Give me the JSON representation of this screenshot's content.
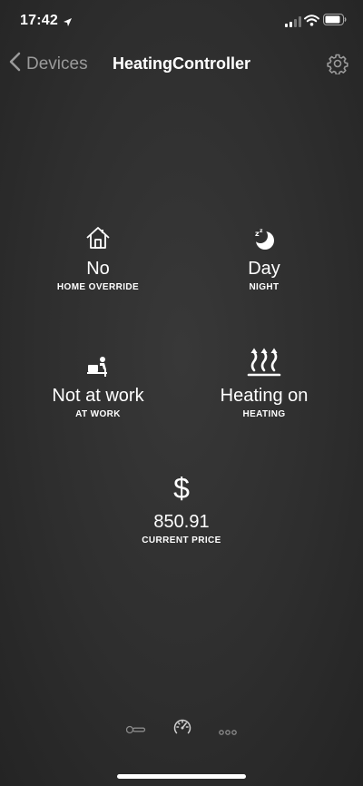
{
  "status_bar": {
    "time": "17:42",
    "icons": [
      "location-arrow-icon",
      "cellular-signal-icon",
      "wifi-icon",
      "battery-icon"
    ]
  },
  "nav": {
    "back_label": "Devices",
    "title": "HeatingController",
    "settings_icon": "gear-icon"
  },
  "tiles": [
    {
      "icon": "house-icon",
      "value": "No",
      "label": "HOME OVERRIDE"
    },
    {
      "icon": "moon-sleep-icon",
      "value": "Day",
      "label": "NIGHT"
    },
    {
      "icon": "desk-worker-icon",
      "value": "Not at work",
      "label": "AT WORK"
    },
    {
      "icon": "heater-icon",
      "value": "Heating on",
      "label": "HEATING"
    },
    {
      "icon": "dollar-icon",
      "value": "850.91",
      "label": "CURRENT PRICE"
    }
  ],
  "price_symbol": "$",
  "toolbar": {
    "items": [
      "switch-icon",
      "gauge-icon",
      "more-icon"
    ]
  },
  "colors": {
    "background": "#2e2e2e",
    "text": "#ffffff",
    "muted": "#9a9a9a"
  }
}
